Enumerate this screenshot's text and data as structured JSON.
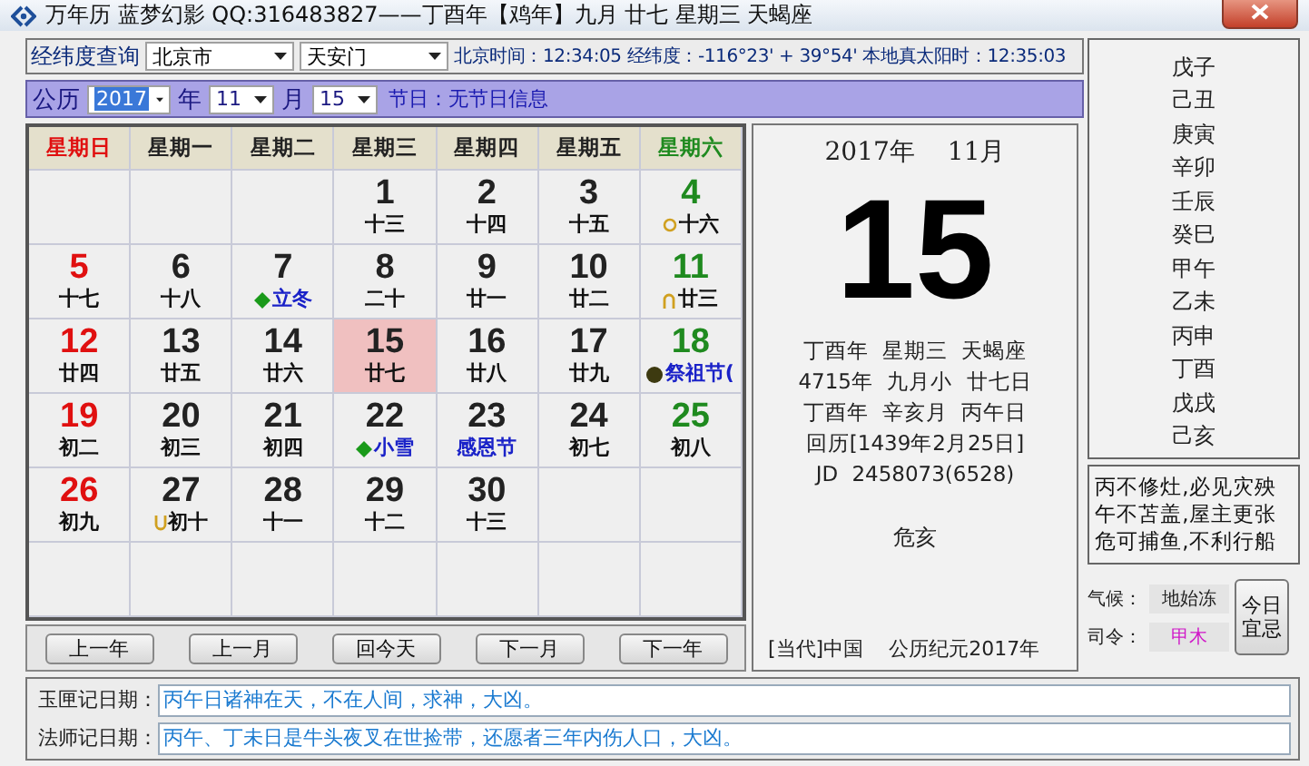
{
  "window": {
    "title": "万年历 蓝梦幻影 QQ:316483827——丁酉年【鸡年】九月 廿七 星期三 天蝎座"
  },
  "location": {
    "label": "经纬度查询",
    "city": "北京市",
    "site": "天安门",
    "info": "北京时间：12:34:05 经纬度：-116°23' + 39°54' 本地真太阳时：12:35:03"
  },
  "date_bar": {
    "calendar": "公历",
    "year": "2017",
    "year_unit": "年",
    "month": "11",
    "month_unit": "月",
    "day": "15",
    "holiday": "节日：无节日信息"
  },
  "weekdays": [
    {
      "label": "星期日",
      "color": "#e01010"
    },
    {
      "label": "星期一",
      "color": "#222222"
    },
    {
      "label": "星期二",
      "color": "#222222"
    },
    {
      "label": "星期三",
      "color": "#222222"
    },
    {
      "label": "星期四",
      "color": "#222222"
    },
    {
      "label": "星期五",
      "color": "#222222"
    },
    {
      "label": "星期六",
      "color": "#1f8a1f"
    }
  ],
  "days": [
    {
      "kind": "empty"
    },
    {
      "kind": "empty"
    },
    {
      "kind": "empty"
    },
    {
      "kind": "plain",
      "day": "1",
      "lunar": "十三",
      "selected": false
    },
    {
      "kind": "plain",
      "day": "2",
      "lunar": "十四",
      "selected": false
    },
    {
      "kind": "plain",
      "day": "3",
      "lunar": "十五",
      "selected": false
    },
    {
      "kind": "moon-round",
      "day": "4",
      "lunar": "十六",
      "selected": false
    },
    {
      "kind": "plain",
      "day": "5",
      "lunar": "十七",
      "selected": false
    },
    {
      "kind": "plain",
      "day": "6",
      "lunar": "十八",
      "selected": false
    },
    {
      "kind": "term",
      "day": "7",
      "lunar": "立冬",
      "selected": false
    },
    {
      "kind": "plain",
      "day": "8",
      "lunar": "二十",
      "selected": false
    },
    {
      "kind": "plain",
      "day": "9",
      "lunar": "廿一",
      "selected": false
    },
    {
      "kind": "plain",
      "day": "10",
      "lunar": "廿二",
      "selected": false
    },
    {
      "kind": "moon-arch",
      "day": "11",
      "lunar": "廿三",
      "selected": false
    },
    {
      "kind": "plain",
      "day": "12",
      "lunar": "廿四",
      "selected": false
    },
    {
      "kind": "plain",
      "day": "13",
      "lunar": "廿五",
      "selected": false
    },
    {
      "kind": "plain",
      "day": "14",
      "lunar": "廿六",
      "selected": false
    },
    {
      "kind": "plain",
      "day": "15",
      "lunar": "廿七",
      "selected": true
    },
    {
      "kind": "plain",
      "day": "16",
      "lunar": "廿八",
      "selected": false
    },
    {
      "kind": "plain",
      "day": "17",
      "lunar": "廿九",
      "selected": false
    },
    {
      "kind": "festival-dot",
      "day": "18",
      "lunar": "祭祖节(",
      "selected": false
    },
    {
      "kind": "plain",
      "day": "19",
      "lunar": "初二",
      "selected": false
    },
    {
      "kind": "plain",
      "day": "20",
      "lunar": "初三",
      "selected": false
    },
    {
      "kind": "plain",
      "day": "21",
      "lunar": "初四",
      "selected": false
    },
    {
      "kind": "term",
      "day": "22",
      "lunar": "小雪",
      "selected": false
    },
    {
      "kind": "festival",
      "day": "23",
      "lunar": "感恩节",
      "selected": false
    },
    {
      "kind": "plain",
      "day": "24",
      "lunar": "初七",
      "selected": false
    },
    {
      "kind": "plain",
      "day": "25",
      "lunar": "初八",
      "selected": false
    },
    {
      "kind": "plain",
      "day": "26",
      "lunar": "初九",
      "selected": false
    },
    {
      "kind": "moon-cup",
      "day": "27",
      "lunar": "初十",
      "selected": false
    },
    {
      "kind": "plain",
      "day": "28",
      "lunar": "十一",
      "selected": false
    },
    {
      "kind": "plain",
      "day": "29",
      "lunar": "十二",
      "selected": false
    },
    {
      "kind": "plain",
      "day": "30",
      "lunar": "十三",
      "selected": false
    },
    {
      "kind": "empty"
    },
    {
      "kind": "empty"
    },
    {
      "kind": "empty"
    },
    {
      "kind": "empty"
    },
    {
      "kind": "empty"
    },
    {
      "kind": "empty"
    },
    {
      "kind": "empty"
    },
    {
      "kind": "empty"
    },
    {
      "kind": "empty"
    }
  ],
  "nav_buttons": [
    "上一年",
    "上一月",
    "回今天",
    "下一月",
    "下一年"
  ],
  "detail": {
    "year": "2017年",
    "month": "11月",
    "day": "15",
    "lines": [
      "丁酉年 星期三 天蝎座",
      "4715年 九月小 廿七日",
      "丁酉年 辛亥月 丙午日",
      "回历[1439年2月25日]",
      "JD 2458073(6528)"
    ],
    "note": "危亥",
    "era": "[当代]中国",
    "epoch": "公历纪元2017年"
  },
  "ganzhi": [
    "戊子",
    "己丑",
    "庚寅",
    "辛卯",
    "壬辰",
    "癸巳",
    "甲午",
    "乙未",
    "丙申",
    "丁酉",
    "戊戌",
    "己亥"
  ],
  "saying": [
    "丙不修灶,必见灾殃",
    "午不苫盖,屋主更张",
    "危可捕鱼,不利行船"
  ],
  "climate": {
    "label": "气候：",
    "value": "地始冻"
  },
  "commander": {
    "label": "司令：",
    "value": "甲木"
  },
  "today_button": "今日宜忌",
  "records": [
    {
      "label": "玉匣记日期：",
      "value": "丙午日诸神在天，不在人间，求神，大凶。"
    },
    {
      "label": "法师记日期：",
      "value": "丙午、丁未日是牛头夜叉在世捡带，还愿者三年内伤人口，大凶。"
    }
  ]
}
